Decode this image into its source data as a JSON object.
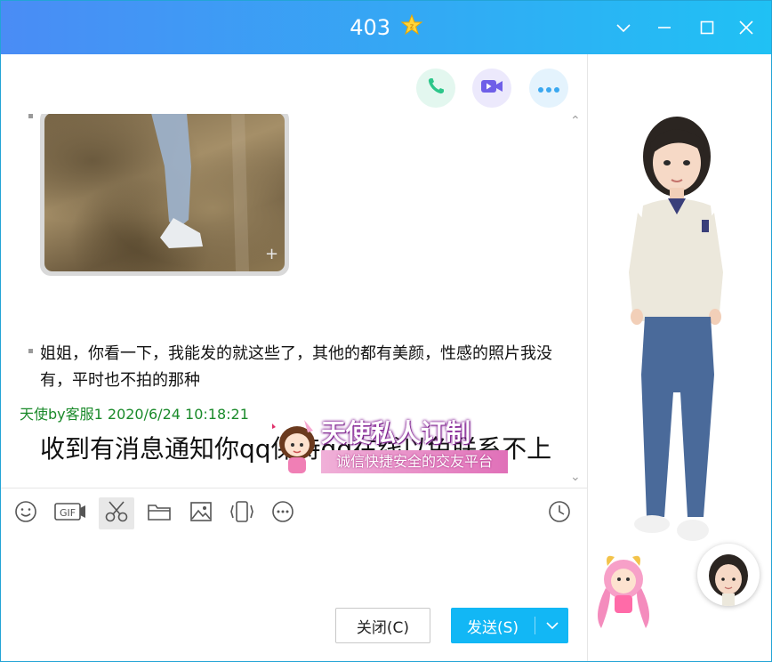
{
  "window": {
    "title": "403",
    "badge_icon": "star-badge-icon"
  },
  "call_buttons": [
    {
      "name": "voice-call-icon",
      "color": "#2cc68a"
    },
    {
      "name": "video-call-icon",
      "color": "#6f5fe8"
    },
    {
      "name": "more-icon",
      "color": "#3aa8f0"
    }
  ],
  "messages": {
    "text1": "姐姐，你看一下，我能发的就这些了，其他的都有美颜，性感的照片我没有，平时也不拍的那种",
    "meta": "天使by客服1 2020/6/24 10:18:21",
    "text2": "收到有消息通知你qq保持qq在线以免联系不上"
  },
  "banner": {
    "title": "天使私人订制",
    "subtitle": "诚信快捷安全的交友平台"
  },
  "toolbar": [
    "emoji-icon",
    "gif-icon",
    "scissors-icon",
    "folder-icon",
    "image-icon",
    "shake-icon",
    "more-options-icon",
    "history-clock-icon"
  ],
  "buttons": {
    "close": "关闭(C)",
    "send": "发送(S)"
  },
  "colors": {
    "accent": "#12b7f5",
    "meta_green": "#1a8a2a"
  }
}
